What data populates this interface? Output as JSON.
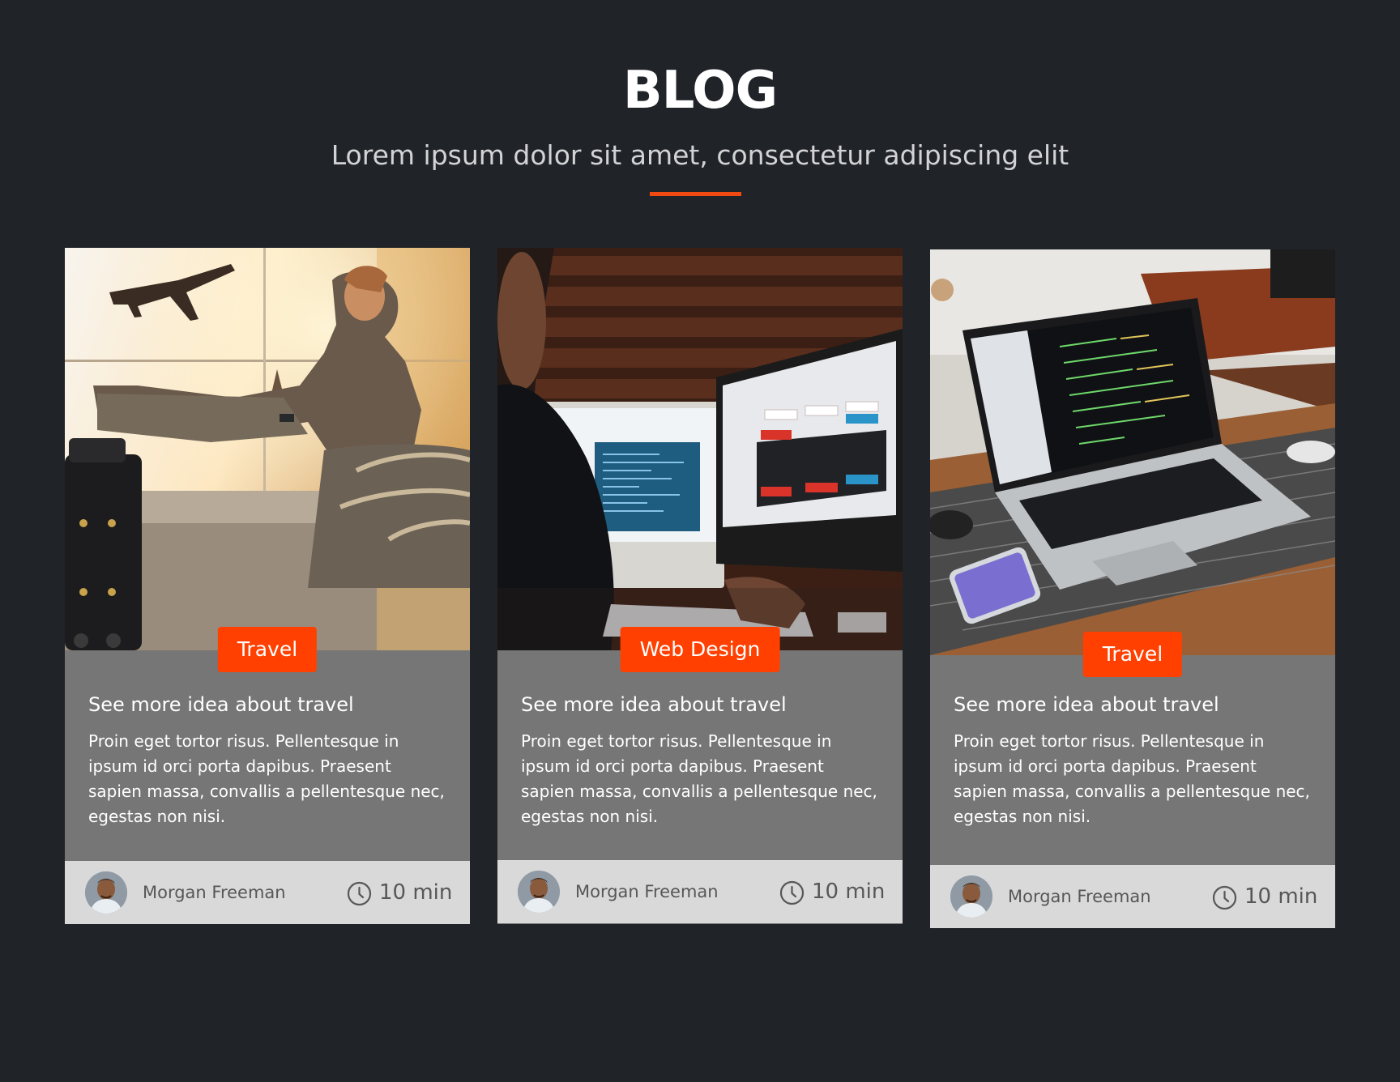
{
  "header": {
    "title": "BLOG",
    "subtitle": "Lorem ipsum dolor sit amet, consectetur adipiscing elit"
  },
  "colors": {
    "background": "#202328",
    "accent": "#ff4000",
    "card_body": "#767676",
    "card_footer": "#d9d9d9"
  },
  "cards": [
    {
      "image": "traveler-at-airport-photo",
      "tag": "Travel",
      "title": "See more idea about travel",
      "text": "Proin eget tortor risus. Pellentesque in ipsum id orci porta dapibus. Praesent sapien massa, convallis a pellentesque nec, egestas non nisi.",
      "author": "Morgan Freeman",
      "duration": "10 min"
    },
    {
      "image": "developer-at-monitors-photo",
      "tag": "Web Design",
      "title": "See more idea about travel",
      "text": "Proin eget tortor risus. Pellentesque in ipsum id orci porta dapibus. Praesent sapien massa, convallis a pellentesque nec, egestas non nisi.",
      "author": "Morgan Freeman",
      "duration": "10 min"
    },
    {
      "image": "laptop-with-code-photo",
      "tag": "Travel",
      "title": "See more idea about travel",
      "text": "Proin eget tortor risus. Pellentesque in ipsum id orci porta dapibus. Praesent sapien massa, convallis a pellentesque nec, egestas non nisi.",
      "author": "Morgan Freeman",
      "duration": "10 min"
    }
  ]
}
